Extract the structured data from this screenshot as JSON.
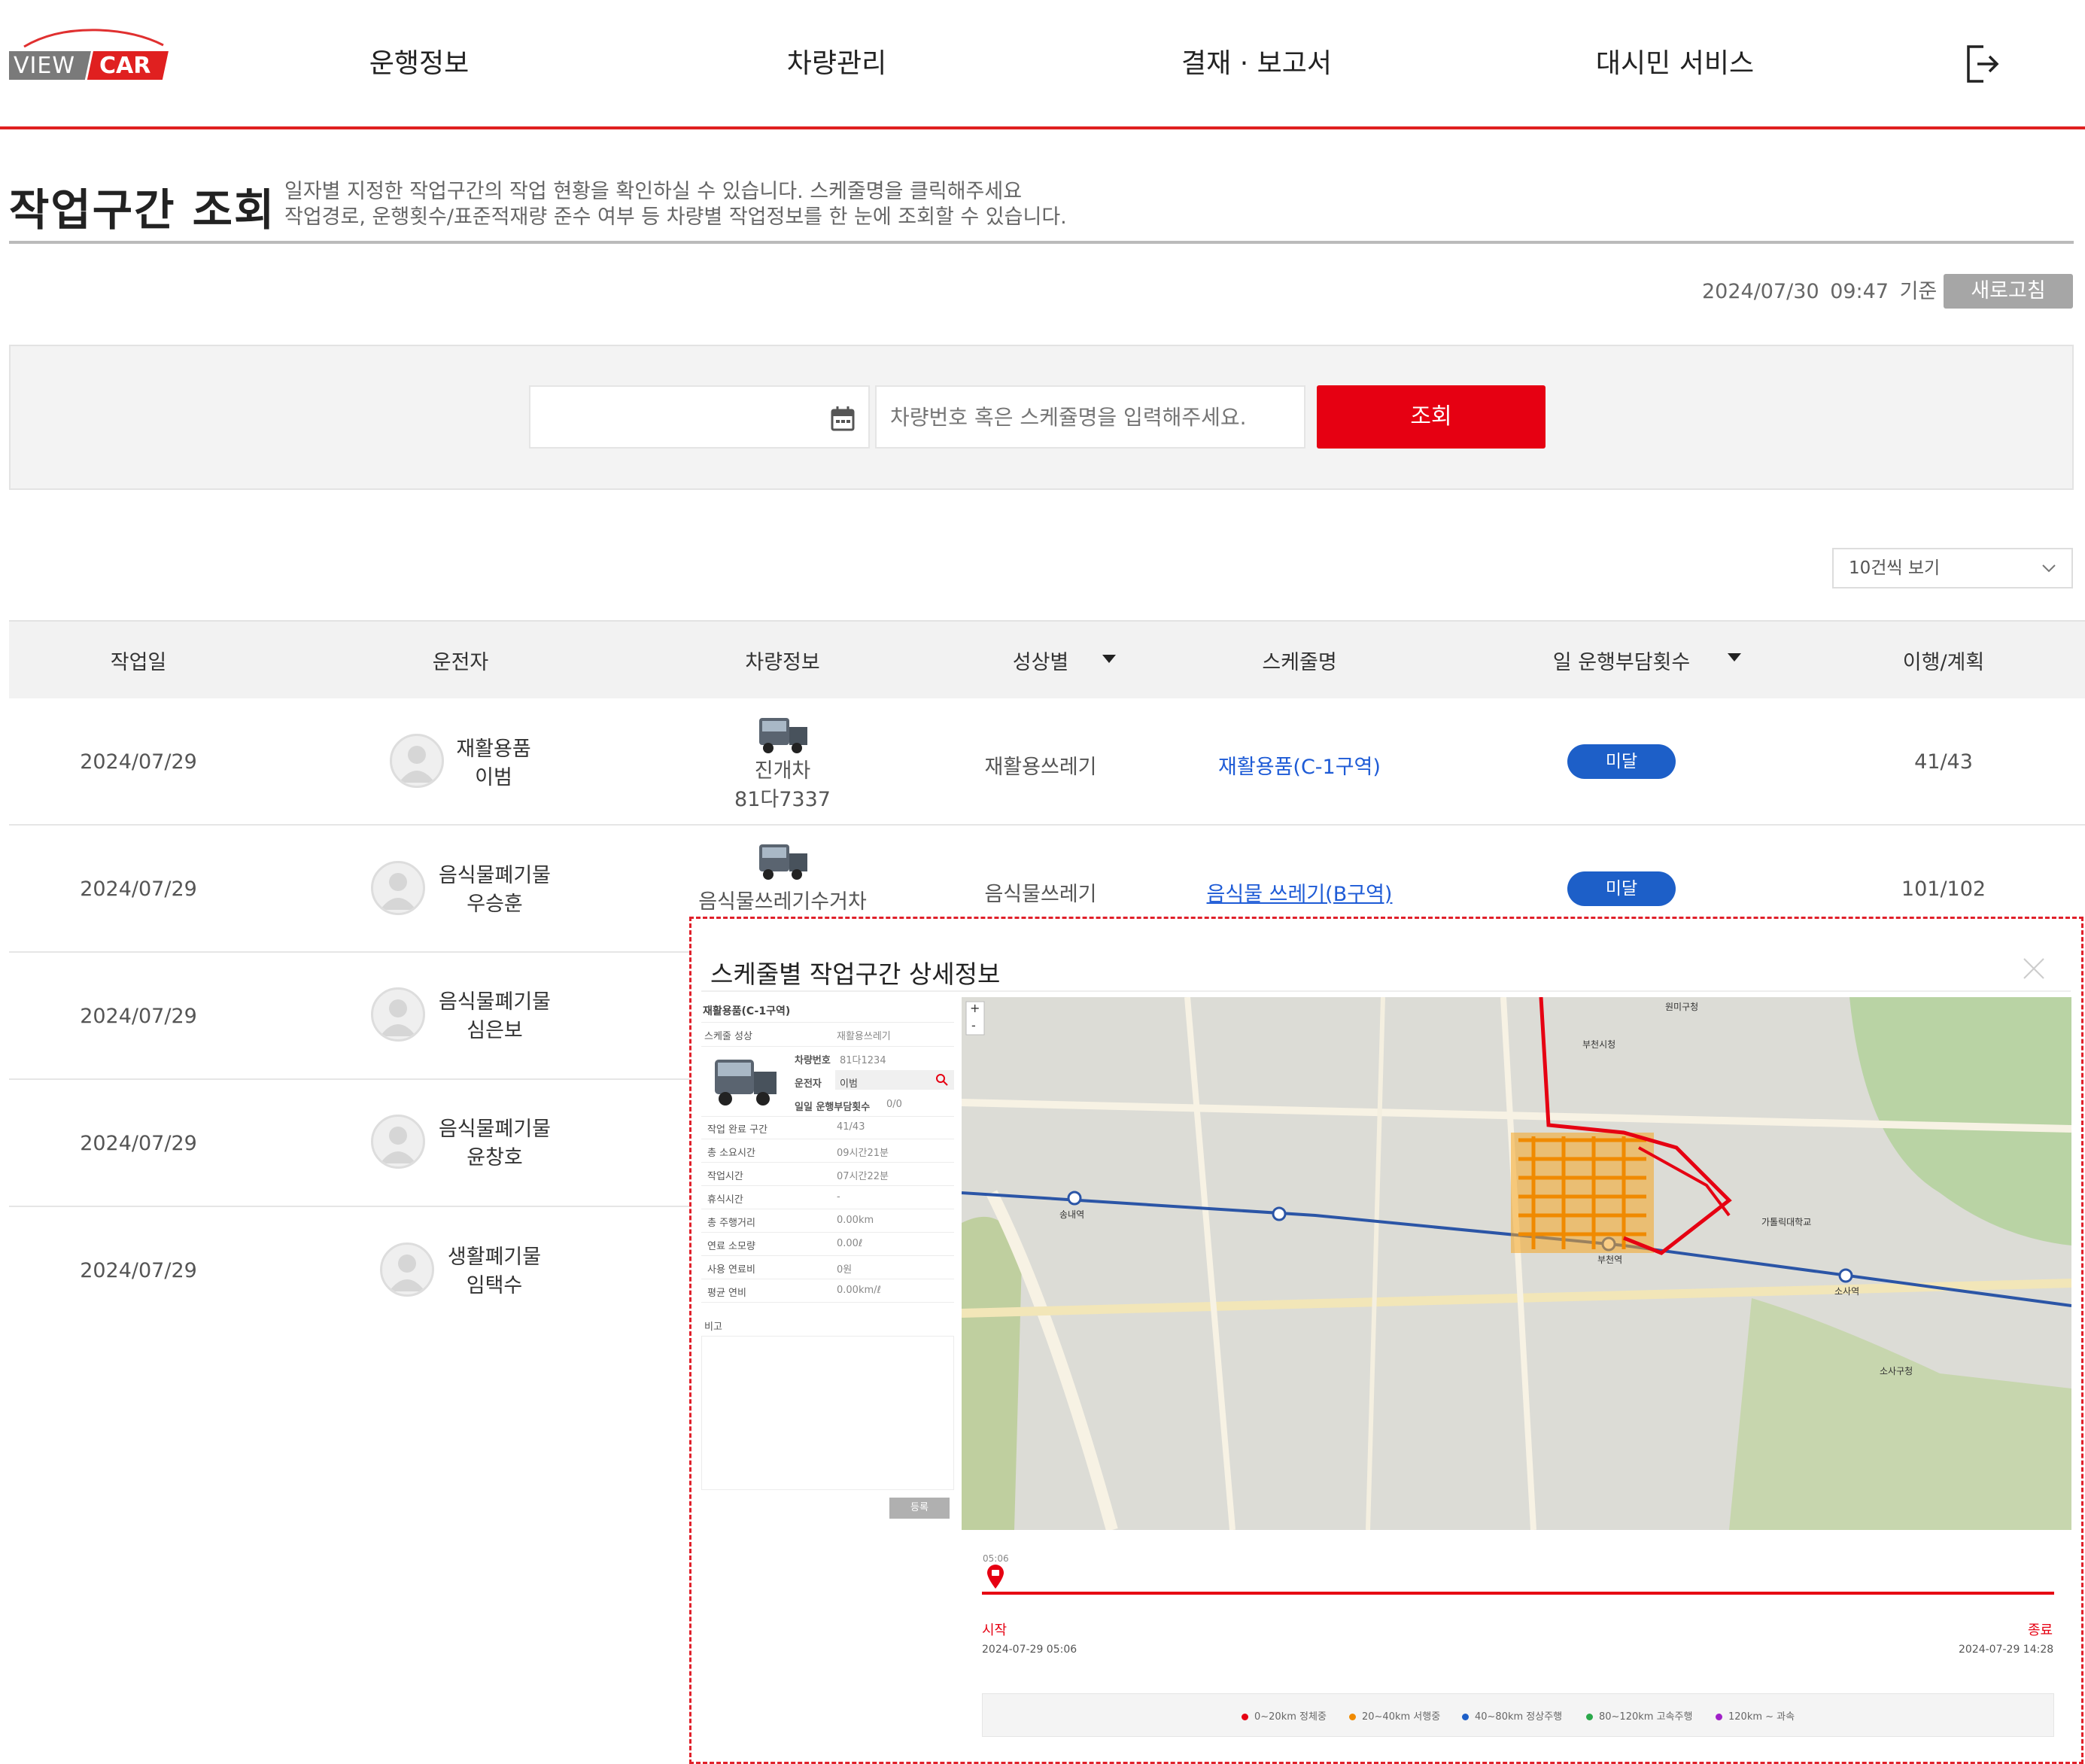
{
  "header": {
    "logo_view": "VIEW",
    "logo_car": "CAR",
    "nav": [
      "운행정보",
      "차량관리",
      "결재 · 보고서",
      "대시민 서비스"
    ]
  },
  "title": {
    "heading": "작업구간 조회",
    "desc1": "일자별 지정한 작업구간의 작업 현황을 확인하실 수 있습니다. 스케줄명을 클릭해주세요",
    "desc2": "작업경로, 운행횟수/표준적재량 준수 여부 등 차량별 작업정보를 한 눈에 조회할 수 있습니다."
  },
  "status": {
    "timestamp": "2024/07/30 09:47 기준",
    "refresh": "새로고침"
  },
  "search": {
    "placeholder": "차량번호 혹은 스케쥴명을 입력해주세요.",
    "button": "조회"
  },
  "page_size": "10건씩 보기",
  "table": {
    "headers": [
      "작업일",
      "운전자",
      "차량정보",
      "성상별",
      "스케줄명",
      "일 운행부담횟수",
      "이행/계획"
    ],
    "rows": [
      {
        "date": "2024/07/29",
        "driver_group": "재활용품",
        "driver_name": "이범",
        "vehicle_type": "진개차",
        "vehicle_no": "81다7337",
        "category": "재활용쓰레기",
        "schedule": "재활용품(C-1구역)",
        "badge": "미달",
        "ratio": "41/43"
      },
      {
        "date": "2024/07/29",
        "driver_group": "음식물폐기물",
        "driver_name": "우승훈",
        "vehicle_type": "음식물쓰레기수거차",
        "vehicle_no": "",
        "category": "음식물쓰레기",
        "schedule": "음식물 쓰레기(B구역)",
        "badge": "미달",
        "ratio": "101/102"
      },
      {
        "date": "2024/07/29",
        "driver_group": "음식물폐기물",
        "driver_name": "심은보"
      },
      {
        "date": "2024/07/29",
        "driver_group": "음식물폐기물",
        "driver_name": "윤창호"
      },
      {
        "date": "2024/07/29",
        "driver_group": "생활폐기물",
        "driver_name": "임택수"
      }
    ]
  },
  "modal": {
    "title": "스케줄별 작업구간 상세정보",
    "schedule_name": "재활용품(C-1구역)",
    "category_label": "스케줄 성상",
    "category_value": "재활용쓰레기",
    "vehicle_no_label": "차량번호",
    "vehicle_no_value": "81다1234",
    "driver_label": "운전자",
    "driver_value": "이범",
    "daily_label": "일일 운행부담횟수",
    "daily_value": "0/0",
    "fields": [
      {
        "label": "작업 완료 구간",
        "value": "41/43"
      },
      {
        "label": "총 소요시간",
        "value": "09시간21분"
      },
      {
        "label": "작업시간",
        "value": "07시간22분"
      },
      {
        "label": "휴식시간",
        "value": "-"
      },
      {
        "label": "총 주행거리",
        "value": "0.00km"
      },
      {
        "label": "연료 소모량",
        "value": "0.00ℓ"
      },
      {
        "label": "사용 연료비",
        "value": "0원"
      },
      {
        "label": "평균 연비",
        "value": "0.00km/ℓ"
      }
    ],
    "memo_label": "비고",
    "register_button": "등록",
    "timeline": {
      "marker_time": "05:06",
      "start_label": "시작",
      "start_time": "2024-07-29 05:06",
      "end_label": "종료",
      "end_time": "2024-07-29 14:28"
    },
    "legend": [
      {
        "label": "0~20km 정체중",
        "color": "#e60012"
      },
      {
        "label": "20~40km 서행중",
        "color": "#f08a00"
      },
      {
        "label": "40~80km 정상주행",
        "color": "#1d5fc8"
      },
      {
        "label": "80~120km 고속주행",
        "color": "#2aa84a"
      },
      {
        "label": "120km ~ 과속",
        "color": "#a020c8"
      }
    ],
    "map_labels": {
      "zoom_in": "+",
      "zoom_out": "-",
      "station_1": "송내역",
      "station_2": "부천역",
      "station_3": "소사역",
      "district_1": "원미구청",
      "district_2": "소사구청",
      "place_1": "부천시청",
      "place_2": "가톨릭대학교"
    }
  }
}
